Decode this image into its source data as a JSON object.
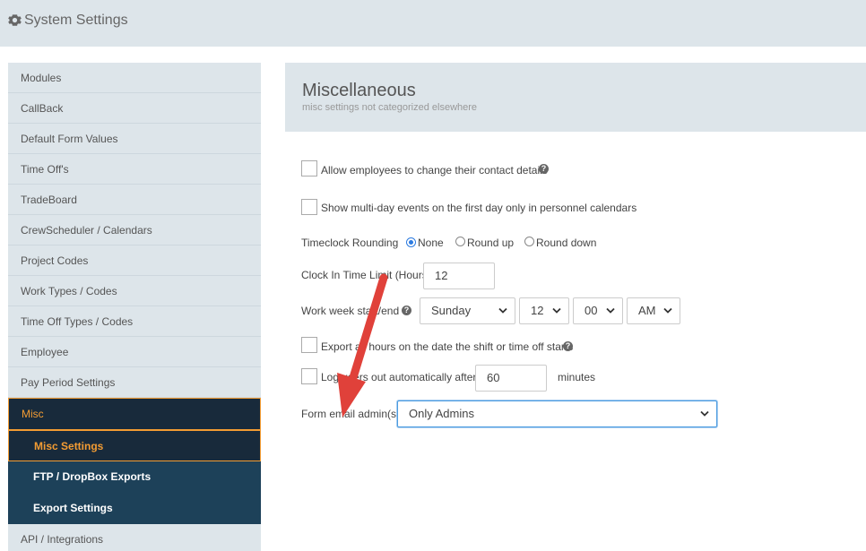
{
  "app": {
    "title": "System Settings",
    "icon": "gear-icon"
  },
  "sidebar": {
    "items": [
      "Modules",
      "CallBack",
      "Default Form Values",
      "Time Off's",
      "TradeBoard",
      "CrewScheduler / Calendars",
      "Project Codes",
      "Work Types / Codes",
      "Time Off Types / Codes",
      "Employee",
      "Pay Period Settings"
    ],
    "active_group": "Misc",
    "sub_items": [
      "Misc Settings",
      "FTP / DropBox Exports",
      "Export Settings"
    ],
    "active_sub_index": 0,
    "trailing_item": "API / Integrations"
  },
  "panel": {
    "title": "Miscellaneous",
    "subtitle": "misc settings not categorized elsewhere"
  },
  "settings": {
    "contact_details_label": "Allow employees to change their contact details",
    "multiday_label": "Show multi-day events on the first day only in personnel calendars",
    "timeclock_rounding_label": "Timeclock Rounding",
    "rounding_options": [
      "None",
      "Round up",
      "Round down"
    ],
    "rounding_selected": "None",
    "clock_in_limit_label": "Clock In Time Limit (Hours)",
    "clock_in_limit_value": "12",
    "work_week_label": "Work week start/end",
    "work_week_day": "Sunday",
    "work_week_hour": "12",
    "work_week_minute": "00",
    "work_week_ampm": "AM",
    "export_label": "Export all hours on the date the shift or time off starts",
    "logout_label": "Log users out automatically after...",
    "logout_value": "60",
    "logout_unit": "minutes",
    "form_email_label": "Form email admin(s):",
    "form_email_value": "Only Admins"
  },
  "colors": {
    "header_bg": "#dde5ea",
    "sidebar_dark": "#182a3b",
    "sidebar_sub": "#1d4159",
    "accent_orange": "#f39c33",
    "arrow_red": "#e0413a"
  }
}
